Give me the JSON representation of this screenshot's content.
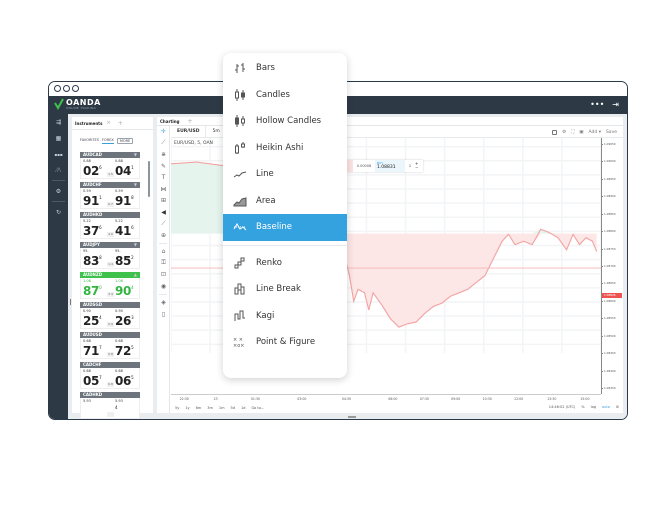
{
  "app": {
    "brand": "OANDA",
    "brand_sub": "ONLINE TRADING",
    "window_controls": [
      "close",
      "minimize",
      "maximize"
    ],
    "appbar_more": "•••",
    "appbar_exit_icon": "logout-icon"
  },
  "leftnav": {
    "items": [
      {
        "name": "trade-icon",
        "glyph": "⇶"
      },
      {
        "name": "calculator-icon",
        "glyph": "▦"
      },
      {
        "name": "positions-icon",
        "glyph": "▪▪▪"
      },
      {
        "name": "analytics-icon",
        "glyph": "⁄Λ"
      },
      {
        "name": "settings-icon",
        "glyph": "⚙"
      },
      {
        "name": "refresh-icon",
        "glyph": "↻"
      }
    ]
  },
  "instruments": {
    "tab_label": "Instruments",
    "tab_close": "×",
    "tab_add": "+",
    "subtabs": [
      "FAVORITES",
      "FOREX",
      "MORE"
    ],
    "cards": [
      {
        "symbol": "AUDCAD",
        "bid_prefix": "0.88",
        "bid_big": "02",
        "bid_sup": "6",
        "ask_prefix": "0.88",
        "ask_big": "04",
        "ask_sup": "1",
        "spread": "1.5",
        "trend": "down"
      },
      {
        "symbol": "AUDCHF",
        "bid_prefix": "0.59",
        "bid_big": "91",
        "bid_sup": "1",
        "ask_prefix": "0.59",
        "ask_big": "91",
        "ask_sup": "8",
        "spread": "0.7",
        "trend": "down"
      },
      {
        "symbol": "AUDHKD",
        "bid_prefix": "5.22",
        "bid_big": "37",
        "bid_sup": "6",
        "ask_prefix": "5.22",
        "ask_big": "41",
        "ask_sup": "6",
        "spread": "4.0",
        "trend": "none"
      },
      {
        "symbol": "AUDJPY",
        "bid_prefix": "95.",
        "bid_big": "83",
        "bid_sup": "8",
        "ask_prefix": "95.",
        "ask_big": "85",
        "ask_sup": "2",
        "spread": "1.4",
        "trend": "down"
      },
      {
        "symbol": "AUDNZD",
        "bid_prefix": "1.08",
        "bid_big": "87",
        "bid_sup": "0",
        "ask_prefix": "1.08",
        "ask_big": "90",
        "ask_sup": "4",
        "spread": "3.4",
        "trend": "up"
      },
      {
        "symbol": "AUDSGD",
        "bid_prefix": "0.90",
        "bid_big": "25",
        "bid_sup": "4",
        "ask_prefix": "0.90",
        "ask_big": "26",
        "ask_sup": "3",
        "spread": "0.9",
        "trend": "none"
      },
      {
        "symbol": "AUDUSD",
        "bid_prefix": "0.68",
        "bid_big": "71",
        "bid_sup": "7",
        "ask_prefix": "0.68",
        "ask_big": "72",
        "ask_sup": "5",
        "spread": "0.8",
        "trend": "none"
      },
      {
        "symbol": "CADCHF",
        "bid_prefix": "0.68",
        "bid_big": "05",
        "bid_sup": "7",
        "ask_prefix": "0.68",
        "ask_big": "06",
        "ask_sup": "5",
        "spread": "0.8",
        "trend": "none"
      },
      {
        "symbol": "CADHKD",
        "bid_prefix": "5.93",
        "bid_big": "",
        "bid_sup": "",
        "ask_prefix": "5.93",
        "ask_big": "",
        "ask_sup": "4",
        "spread": "",
        "trend": "none"
      }
    ],
    "floatbar": [
      "✓",
      "☰",
      "▭"
    ]
  },
  "chart": {
    "tab_label": "Charting",
    "tab_add": "+",
    "symbol": "EUR/USD",
    "interval": "5m",
    "legend": "EUR/USD, 5, OAN",
    "top_actions": {
      "add_label": "Add ▾",
      "save_label": "Save"
    },
    "trade": {
      "spread": "0.00008",
      "buy_label": "BUY",
      "buy_price": "1.08831",
      "qty": "1",
      "plus": "+",
      "minus": "−"
    },
    "price_labels": [
      "1.09050",
      "1.09000",
      "1.08950",
      "1.08900",
      "1.08850",
      "1.08800",
      "1.08750",
      "1.08700",
      "1.08650",
      "1.08600",
      "1.08550",
      "1.08500",
      "1.08450",
      "1.08400",
      "1.08350"
    ],
    "current_price": "1.08826",
    "time_labels": [
      "22:30",
      "23",
      "01:30",
      "03:00",
      "04:30",
      "06:00",
      "07:30",
      "09:00",
      "10:30",
      "12:00",
      "13:30",
      "15:00"
    ],
    "ranges": [
      "5y",
      "1y",
      "6m",
      "3m",
      "1m",
      "5d",
      "1d",
      "Go to..."
    ],
    "clock": "14:46:02 (UTC)",
    "scale_opts": [
      "%",
      "log",
      "auto"
    ],
    "colors": {
      "up_fill": "#e6f4ee",
      "up_line": "#9fd8bf",
      "down_fill": "#fde6e6",
      "down_line": "#f2a5a5",
      "accent": "#35a2e0"
    }
  },
  "chart_type_menu": {
    "items": [
      {
        "label": "Bars",
        "icon": "bars-icon"
      },
      {
        "label": "Candles",
        "icon": "candles-icon"
      },
      {
        "label": "Hollow Candles",
        "icon": "hollow-candles-icon"
      },
      {
        "label": "Heikin Ashi",
        "icon": "heikin-ashi-icon"
      },
      {
        "label": "Line",
        "icon": "line-icon"
      },
      {
        "label": "Area",
        "icon": "area-icon"
      },
      {
        "label": "Baseline",
        "icon": "baseline-icon",
        "selected": true
      },
      {
        "label": "Renko",
        "icon": "renko-icon"
      },
      {
        "label": "Line Break",
        "icon": "line-break-icon"
      },
      {
        "label": "Kagi",
        "icon": "kagi-icon"
      },
      {
        "label": "Point & Figure",
        "icon": "point-figure-icon"
      }
    ]
  }
}
